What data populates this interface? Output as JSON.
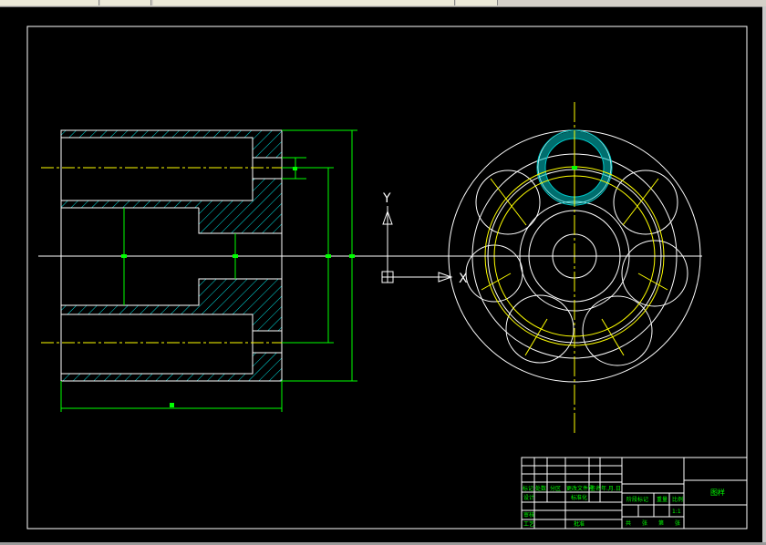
{
  "colors": {
    "background": "#000000",
    "outline": "#ffffff",
    "dimension": "#00ff00",
    "centerline": "#ffff00",
    "hatch": "#00e0e0",
    "hole": "#00c8c8"
  },
  "ucs": {
    "y_label": "Y",
    "x_label": "X"
  },
  "title_block": {
    "row1": [
      "标记",
      "处数",
      "分区",
      "更改文件号",
      "签名",
      "年.月.日"
    ],
    "design": "设计",
    "standardize": "标准化",
    "stage_mark": "阶段标记",
    "weight": "重量",
    "scale": "比例",
    "scale_value": "1:1",
    "review": "审核",
    "process": "工艺",
    "approve": "批准",
    "sheets": [
      "共",
      "张",
      "第",
      "张"
    ],
    "drawing_name": "图样"
  }
}
